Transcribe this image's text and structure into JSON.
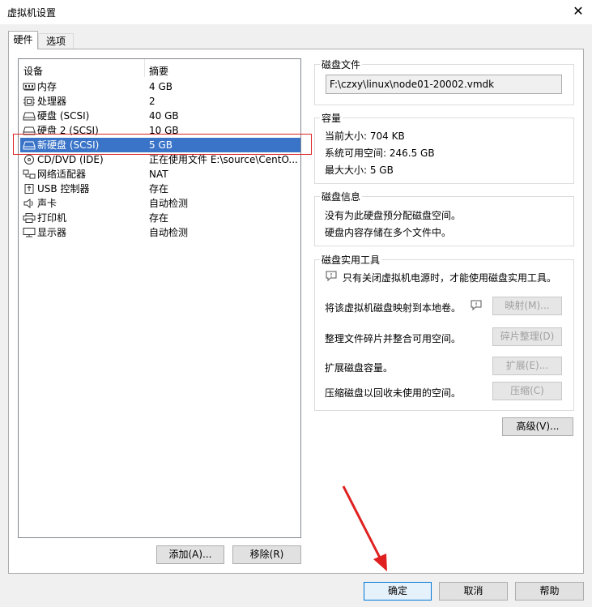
{
  "window": {
    "title": "虚拟机设置",
    "close_glyph": "✕"
  },
  "tabs": [
    {
      "label": "硬件",
      "active": true
    },
    {
      "label": "选项",
      "active": false
    }
  ],
  "device_list": {
    "headers": {
      "device": "设备",
      "summary": "摘要"
    },
    "rows": [
      {
        "name": "内存",
        "summary": "4 GB",
        "icon": "memory-icon"
      },
      {
        "name": "处理器",
        "summary": "2",
        "icon": "cpu-icon"
      },
      {
        "name": "硬盘 (SCSI)",
        "summary": "40 GB",
        "icon": "hard-disk-icon"
      },
      {
        "name": "硬盘 2 (SCSI)",
        "summary": "10 GB",
        "icon": "hard-disk-icon"
      },
      {
        "name": "新硬盘 (SCSI)",
        "summary": "5 GB",
        "icon": "hard-disk-icon",
        "selected": true
      },
      {
        "name": "CD/DVD (IDE)",
        "summary": "正在使用文件 E:\\source\\CentO...",
        "icon": "cd-dvd-icon"
      },
      {
        "name": "网络适配器",
        "summary": "NAT",
        "icon": "network-adapter-icon"
      },
      {
        "name": "USB 控制器",
        "summary": "存在",
        "icon": "usb-icon"
      },
      {
        "name": "声卡",
        "summary": "自动检测",
        "icon": "speaker-icon"
      },
      {
        "name": "打印机",
        "summary": "存在",
        "icon": "printer-icon"
      },
      {
        "name": "显示器",
        "summary": "自动检测",
        "icon": "monitor-icon"
      }
    ],
    "add_button": "添加(A)...",
    "remove_button": "移除(R)"
  },
  "disk_file": {
    "legend": "磁盘文件",
    "path": "F:\\czxy\\linux\\node01-20002.vmdk"
  },
  "capacity": {
    "legend": "容量",
    "current_size": "当前大小: 704 KB",
    "system_free": "系统可用空间: 246.5 GB",
    "max_size": "最大大小: 5 GB"
  },
  "disk_info": {
    "legend": "磁盘信息",
    "line1": "没有为此硬盘预分配磁盘空间。",
    "line2": "硬盘内容存储在多个文件中。"
  },
  "disk_utilities": {
    "legend": "磁盘实用工具",
    "notice": "只有关闭虚拟机电源时，才能使用磁盘实用工具。",
    "map_text": "将该虚拟机磁盘映射到本地卷。",
    "map_button": "映射(M)...",
    "defrag_text": "整理文件碎片并整合可用空间。",
    "defrag_button": "碎片整理(D)",
    "expand_text": "扩展磁盘容量。",
    "expand_button": "扩展(E)...",
    "compact_text": "压缩磁盘以回收未使用的空间。",
    "compact_button": "压缩(C)"
  },
  "advanced_button": "高级(V)...",
  "footer": {
    "ok": "确定",
    "cancel": "取消",
    "help": "帮助"
  },
  "colors": {
    "selection": "#3a74c8",
    "highlight_box": "#dd2222",
    "arrow": "#e02020"
  }
}
